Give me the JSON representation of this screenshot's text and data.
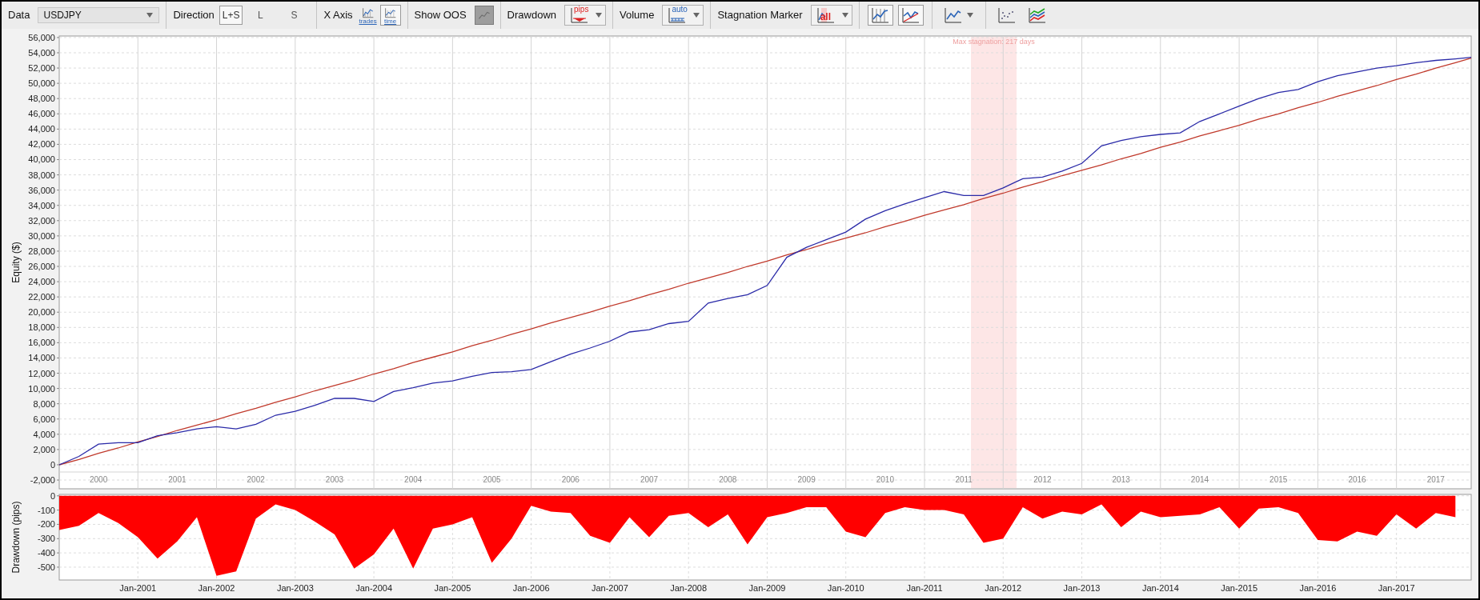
{
  "toolbar": {
    "groups": [
      {
        "kind": "combo",
        "label": "Data",
        "value": "USDJPY"
      },
      {
        "kind": "segmented",
        "label": "Direction",
        "options": [
          {
            "label": "L+S",
            "selected": true
          },
          {
            "label": "L",
            "selected": false
          },
          {
            "label": "S",
            "selected": false
          }
        ]
      },
      {
        "kind": "icon_choice",
        "label": "X Axis",
        "options": [
          {
            "label": "trades",
            "selected": false
          },
          {
            "label": "time",
            "selected": true
          }
        ]
      },
      {
        "kind": "toggle",
        "label": "Show OOS",
        "on": false
      },
      {
        "kind": "icon_dropdown",
        "label": "Drawdown",
        "icon_text": "pips"
      },
      {
        "kind": "icon_dropdown",
        "label": "Volume",
        "icon_text": "auto"
      },
      {
        "kind": "icon_dropdown",
        "label": "Stagnation Marker",
        "icon_text": "all"
      },
      {
        "kind": "icons",
        "buttons": [
          {
            "selected": true,
            "dropdown": false
          },
          {
            "selected": true,
            "dropdown": false
          }
        ]
      },
      {
        "kind": "icons",
        "buttons": [
          {
            "selected": false,
            "dropdown": true
          }
        ]
      },
      {
        "kind": "icons",
        "buttons": [
          {
            "selected": false,
            "dropdown": false
          },
          {
            "selected": false,
            "dropdown": false
          }
        ]
      }
    ]
  },
  "equity_chart": {
    "chart_data": {
      "type": "line",
      "ylabel": "Equity ($)",
      "xlim": [
        1999.5,
        2017.45
      ],
      "ylim": [
        -3150,
        56200
      ],
      "x": [
        1999.5,
        1999.75,
        2000,
        2000.25,
        2000.5,
        2000.75,
        2001,
        2001.25,
        2001.5,
        2001.75,
        2002,
        2002.25,
        2002.5,
        2002.75,
        2003,
        2003.25,
        2003.5,
        2003.75,
        2004,
        2004.25,
        2004.5,
        2004.75,
        2005,
        2005.25,
        2005.5,
        2005.75,
        2006,
        2006.25,
        2006.5,
        2006.75,
        2007,
        2007.25,
        2007.5,
        2007.75,
        2008,
        2008.25,
        2008.5,
        2008.75,
        2009,
        2009.25,
        2009.5,
        2009.75,
        2010,
        2010.25,
        2010.5,
        2010.75,
        2011,
        2011.25,
        2011.5,
        2011.75,
        2012,
        2012.25,
        2012.5,
        2012.75,
        2013,
        2013.25,
        2013.5,
        2013.75,
        2014,
        2014.25,
        2014.5,
        2014.75,
        2015,
        2015.25,
        2015.5,
        2015.75,
        2016,
        2016.25,
        2016.5,
        2016.75,
        2017,
        2017.25,
        2017.45
      ],
      "series": [
        {
          "color": "#2a2aa8",
          "values": [
            0,
            1100,
            2700,
            2900,
            2900,
            3800,
            4200,
            4700,
            5000,
            4700,
            5300,
            6500,
            7000,
            7800,
            8700,
            8700,
            8300,
            9600,
            10100,
            10700,
            11000,
            11600,
            12100,
            12200,
            12500,
            13500,
            14500,
            15300,
            16200,
            17400,
            17700,
            18500,
            18800,
            21200,
            21800,
            22300,
            23500,
            27200,
            28500,
            29500,
            30500,
            32200,
            33300,
            34200,
            35000,
            35800,
            35300,
            35300,
            36300,
            37500,
            37700,
            38500,
            39500,
            41800,
            42500,
            43000,
            43300,
            43500,
            45000,
            46000,
            47000,
            48000,
            48800,
            49200,
            50200,
            51000,
            51500,
            52000,
            52300,
            52700,
            53000,
            53200,
            53400
          ]
        },
        {
          "color": "#c0392b",
          "values": [
            0,
            700,
            1500,
            2200,
            3000,
            3700,
            4500,
            5200,
            5900,
            6700,
            7400,
            8200,
            8900,
            9700,
            10400,
            11100,
            11900,
            12600,
            13400,
            14100,
            14800,
            15600,
            16300,
            17100,
            17800,
            18600,
            19300,
            20000,
            20800,
            21500,
            22300,
            23000,
            23800,
            24500,
            25200,
            26000,
            26700,
            27500,
            28200,
            29000,
            29700,
            30400,
            31200,
            31900,
            32700,
            33400,
            34100,
            34900,
            35600,
            36400,
            37100,
            37900,
            38600,
            39300,
            40100,
            40800,
            41600,
            42300,
            43100,
            43800,
            44500,
            45300,
            46000,
            46800,
            47500,
            48300,
            49000,
            49700,
            50500,
            51200,
            52000,
            52700,
            53300
          ]
        }
      ],
      "xticks": [
        2000,
        2001,
        2002,
        2003,
        2004,
        2005,
        2006,
        2007,
        2008,
        2009,
        2010,
        2011,
        2012,
        2013,
        2014,
        2015,
        2016,
        2017
      ],
      "yticks": [
        {
          "value": -2000,
          "label": "-2,000"
        },
        {
          "value": 0,
          "label": "0"
        },
        {
          "value": 2000,
          "label": "2,000"
        },
        {
          "value": 4000,
          "label": "4,000"
        },
        {
          "value": 6000,
          "label": "6,000"
        },
        {
          "value": 8000,
          "label": "8,000"
        },
        {
          "value": 10000,
          "label": "10,000"
        },
        {
          "value": 12000,
          "label": "12,000"
        },
        {
          "value": 14000,
          "label": "14,000"
        },
        {
          "value": 16000,
          "label": "16,000"
        },
        {
          "value": 18000,
          "label": "18,000"
        },
        {
          "value": 20000,
          "label": "20,000"
        },
        {
          "value": 22000,
          "label": "22,000"
        },
        {
          "value": 24000,
          "label": "24,000"
        },
        {
          "value": 26000,
          "label": "26,000"
        },
        {
          "value": 28000,
          "label": "28,000"
        },
        {
          "value": 30000,
          "label": "30,000"
        },
        {
          "value": 32000,
          "label": "32,000"
        },
        {
          "value": 34000,
          "label": "34,000"
        },
        {
          "value": 36000,
          "label": "36,000"
        },
        {
          "value": 38000,
          "label": "38,000"
        },
        {
          "value": 40000,
          "label": "40,000"
        },
        {
          "value": 42000,
          "label": "42,000"
        },
        {
          "value": 44000,
          "label": "44,000"
        },
        {
          "value": 46000,
          "label": "46,000"
        },
        {
          "value": 48000,
          "label": "48,000"
        },
        {
          "value": 50000,
          "label": "50,000"
        },
        {
          "value": 52000,
          "label": "52,000"
        },
        {
          "value": 54000,
          "label": "54,000"
        },
        {
          "value": 56000,
          "label": "56,000"
        }
      ],
      "grid": true,
      "bands": [
        {
          "axis": "x",
          "from": 2011.09,
          "to": 2011.67,
          "label": "Max stagnation: 217 days"
        }
      ]
    }
  },
  "drawdown_chart": {
    "chart_data": {
      "type": "area",
      "ylabel": "Drawdown (pips)",
      "ylim": [
        -590,
        10
      ],
      "grid": true,
      "categories": [
        null,
        null,
        null,
        null,
        "Jan-2001",
        null,
        null,
        null,
        "Jan-2002",
        null,
        null,
        null,
        "Jan-2003",
        null,
        null,
        null,
        "Jan-2004",
        null,
        null,
        null,
        "Jan-2005",
        null,
        null,
        null,
        "Jan-2006",
        null,
        null,
        null,
        "Jan-2007",
        null,
        null,
        null,
        "Jan-2008",
        null,
        null,
        null,
        "Jan-2009",
        null,
        null,
        null,
        "Jan-2010",
        null,
        null,
        null,
        "Jan-2011",
        null,
        null,
        null,
        "Jan-2012",
        null,
        null,
        null,
        "Jan-2013",
        null,
        null,
        null,
        "Jan-2014",
        null,
        null,
        null,
        "Jan-2015",
        null,
        null,
        null,
        "Jan-2016",
        null,
        null,
        null,
        "Jan-2017",
        null,
        null,
        null
      ],
      "series": [
        {
          "color": "#ff0000",
          "values": [
            -240,
            -210,
            -120,
            -190,
            -290,
            -440,
            -320,
            -150,
            -560,
            -530,
            -160,
            -60,
            -100,
            -180,
            -270,
            -510,
            -410,
            -230,
            -510,
            -230,
            -200,
            -150,
            -470,
            -300,
            -70,
            -110,
            -120,
            -280,
            -330,
            -150,
            -290,
            -140,
            -120,
            -220,
            -130,
            -340,
            -150,
            -120,
            -80,
            -80,
            -250,
            -290,
            -120,
            -80,
            -100,
            -100,
            -130,
            -330,
            -300,
            -80,
            -160,
            -110,
            -130,
            -60,
            -220,
            -110,
            -150,
            -140,
            -130,
            -80,
            -230,
            -90,
            -80,
            -120,
            -310,
            -320,
            -250,
            -280,
            -130,
            -230,
            -120,
            -150
          ]
        }
      ],
      "yticks": [
        0,
        -100,
        -200,
        -300,
        -400,
        -500
      ]
    }
  }
}
